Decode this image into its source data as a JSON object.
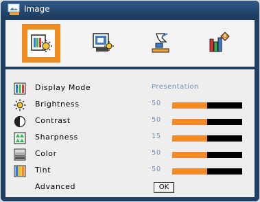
{
  "title": "Image",
  "tabs": [
    {
      "name": "image-tab-icon",
      "selected": true
    },
    {
      "name": "display-tab-icon",
      "selected": false
    },
    {
      "name": "setup-tab-icon",
      "selected": false
    },
    {
      "name": "options-tab-icon",
      "selected": false
    }
  ],
  "rows": {
    "display_mode": {
      "label": "Display Mode",
      "value": "Presentation",
      "icon": "display-mode-icon"
    },
    "brightness": {
      "label": "Brightness",
      "value": "50",
      "level_percent": 50,
      "icon": "brightness-icon"
    },
    "contrast": {
      "label": "Contrast",
      "value": "50",
      "level_percent": 50,
      "icon": "contrast-icon"
    },
    "sharpness": {
      "label": "Sharpness",
      "value": "15",
      "level_percent": 50,
      "icon": "sharpness-icon"
    },
    "color": {
      "label": "Color",
      "value": "50",
      "level_percent": 50,
      "icon": "color-icon"
    },
    "tint": {
      "label": "Tint",
      "value": "50",
      "level_percent": 50,
      "icon": "tint-icon"
    },
    "advanced": {
      "label": "Advanced",
      "button": "OK"
    }
  },
  "colors": {
    "accent": "#f28a20",
    "value_text": "#6f92b8",
    "title_bar": "#1f3f63",
    "slider_track": "#000000"
  }
}
